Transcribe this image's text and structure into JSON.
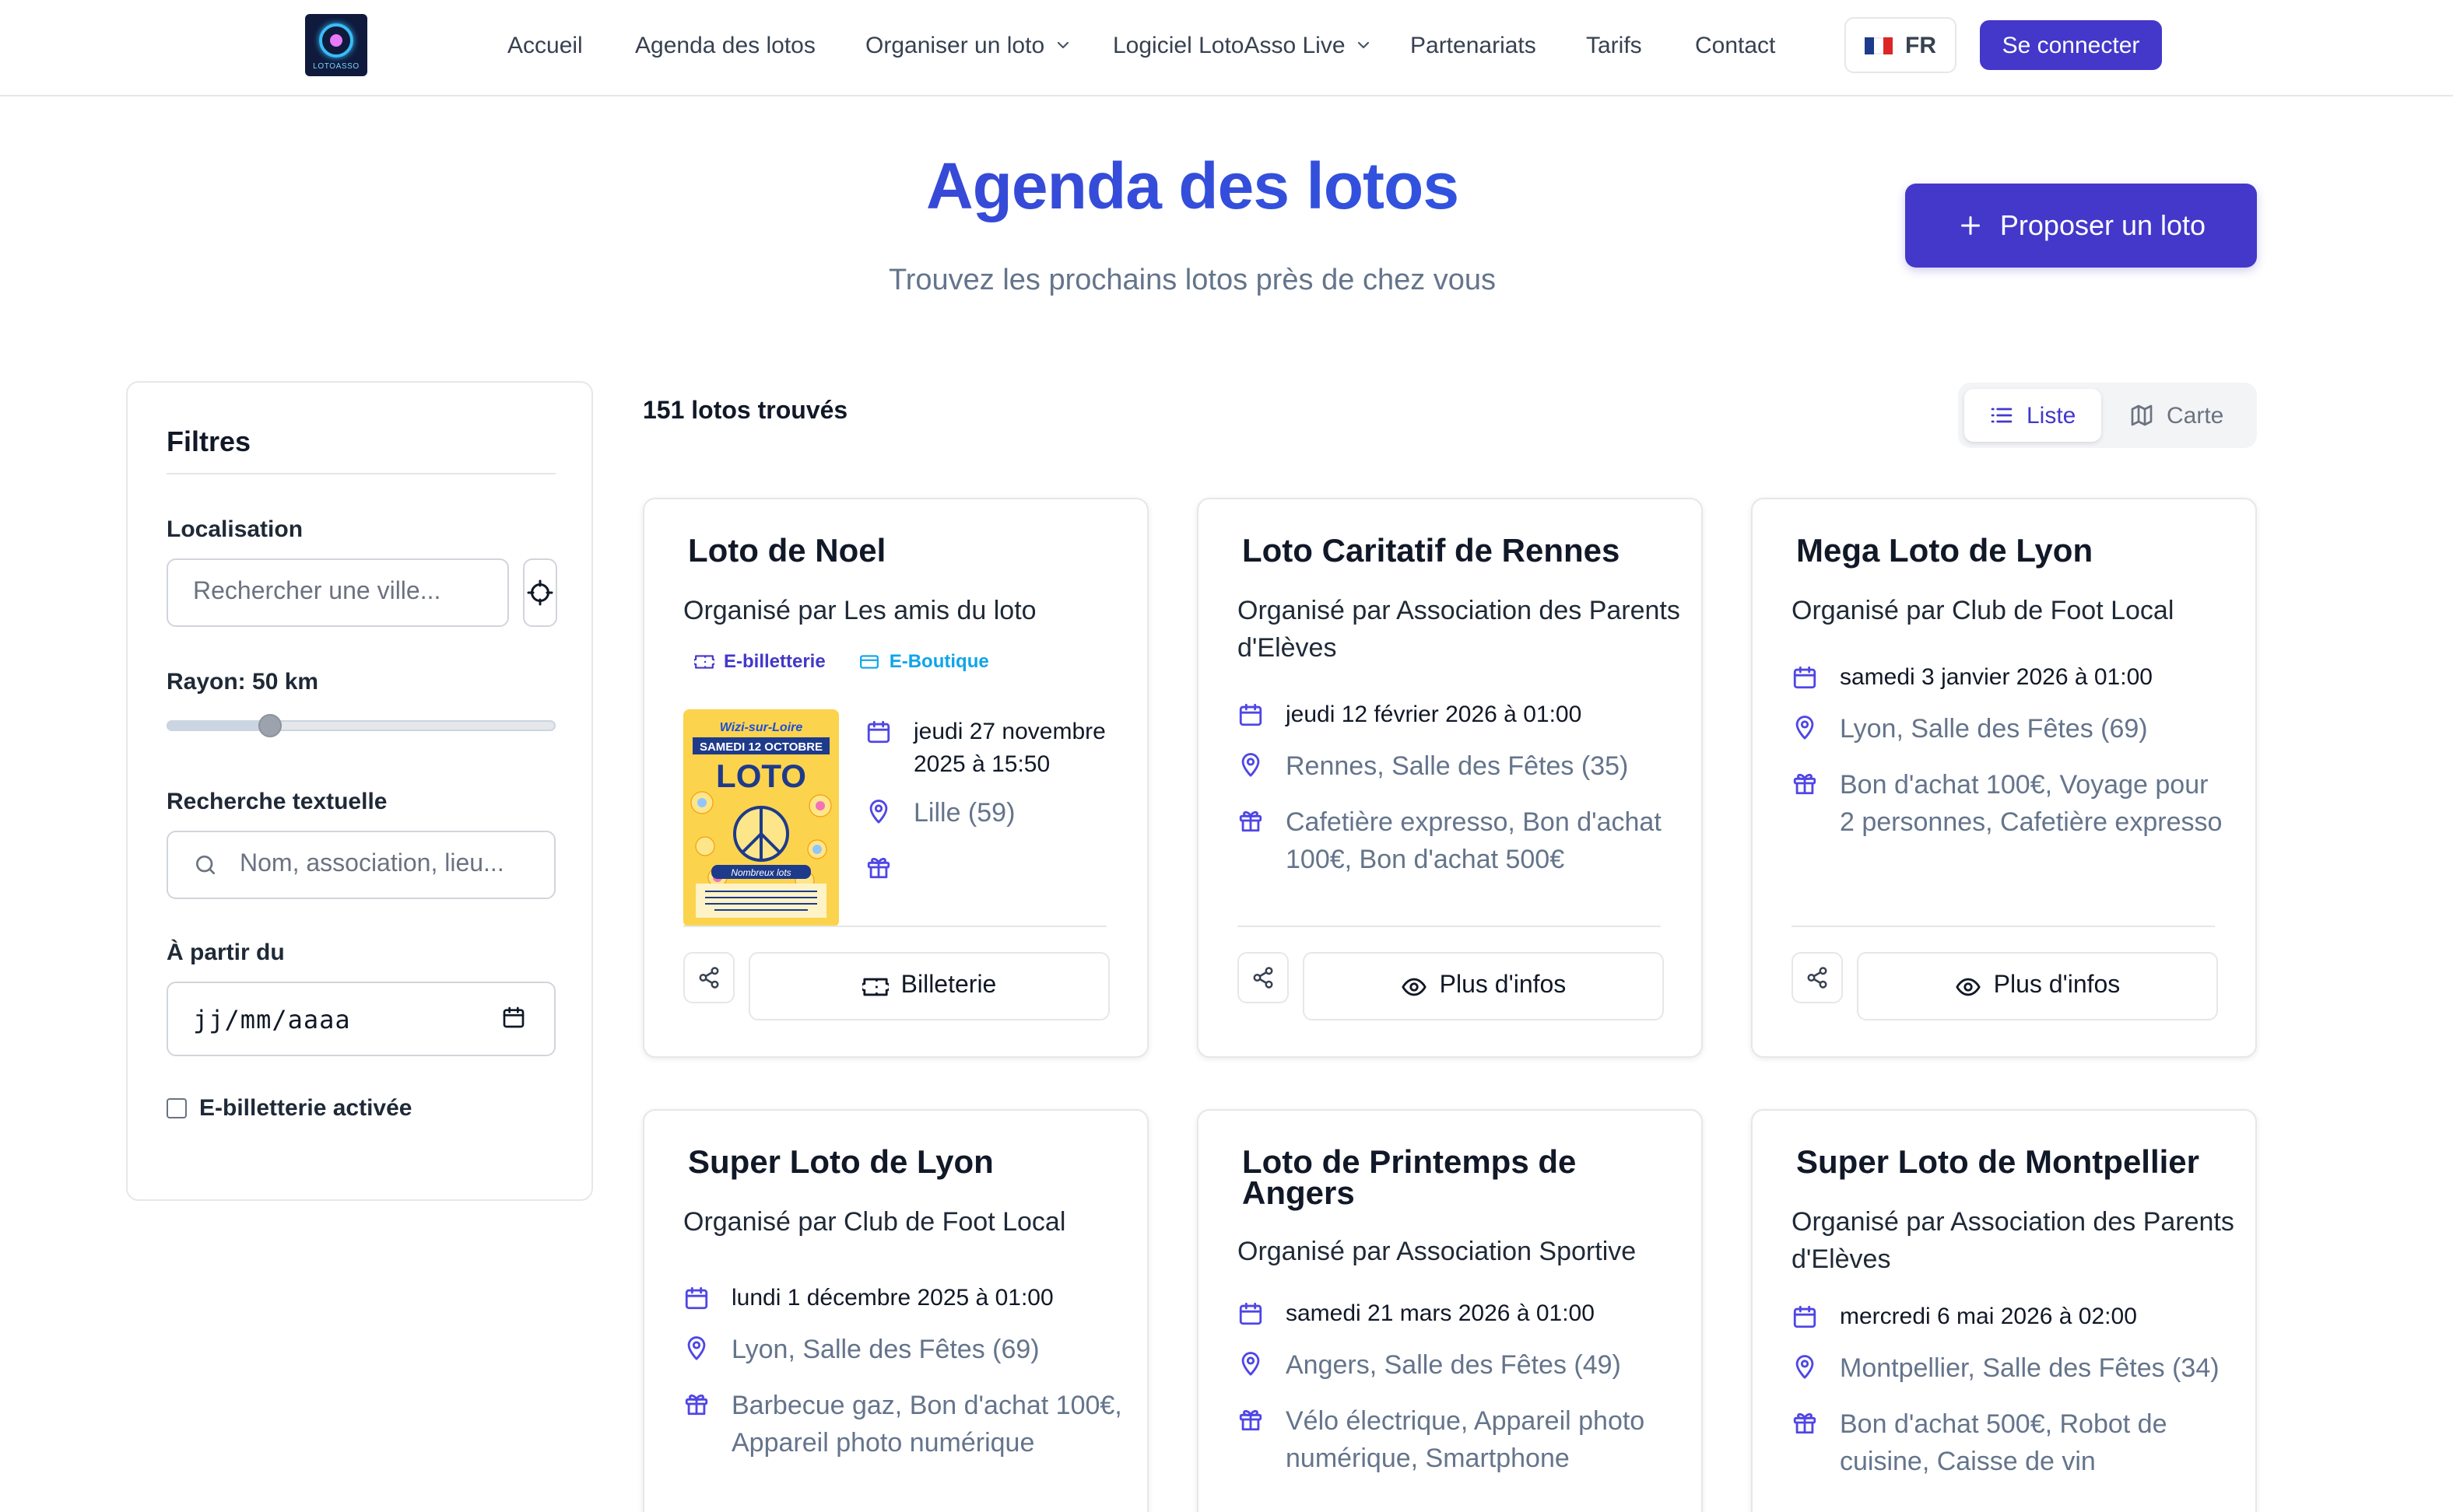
{
  "header": {
    "logo_text": "LOTOASSO",
    "nav": {
      "accueil": "Accueil",
      "agenda": "Agenda des lotos",
      "organiser": "Organiser un loto",
      "logiciel": "Logiciel LotoAsso Live",
      "partenariats": "Partenariats",
      "tarifs": "Tarifs",
      "contact": "Contact"
    },
    "lang": "FR",
    "login": "Se connecter"
  },
  "hero": {
    "title": "Agenda des lotos",
    "subtitle": "Trouvez les prochains lotos près de chez vous",
    "propose_label": "Proposer un loto"
  },
  "filters": {
    "title": "Filtres",
    "location_label": "Localisation",
    "location_placeholder": "Rechercher une ville...",
    "radius_label": "Rayon: 50 km",
    "radius_value_km": 50,
    "radius_slider_fraction": 0.25,
    "text_search_label": "Recherche textuelle",
    "text_search_placeholder": "Nom, association, lieu...",
    "from_label": "À partir du",
    "date_placeholder": "jj/mm/aaaa",
    "eticket_label": "E-billetterie activée",
    "eticket_checked": false
  },
  "results": {
    "count_label": "151 lotos trouvés",
    "view_list": "Liste",
    "view_map": "Carte",
    "active_view": "Liste"
  },
  "poster": {
    "line1": "Wizi-sur-Loire",
    "line2": "SAMEDI 12 OCTOBRE",
    "line3": "LOTO",
    "line4": "Nombreux lots"
  },
  "cards": [
    {
      "title": "Loto de Noel",
      "organizer": "Organisé par Les amis du loto",
      "badges": [
        "E-billetterie",
        "E-Boutique"
      ],
      "date": "jeudi 27 novembre 2025 à 15:50",
      "location": "Lille (59)",
      "prizes": "",
      "action": "Billeterie"
    },
    {
      "title": "Loto Caritatif de Rennes",
      "organizer": "Organisé par Association des Parents d'Elèves",
      "date": "jeudi 12 février 2026 à 01:00",
      "location": "Rennes, Salle des Fêtes (35)",
      "prizes": "Cafetière expresso, Bon d'achat 100€, Bon d'achat 500€",
      "action": "Plus d'infos"
    },
    {
      "title": "Mega Loto de Lyon",
      "organizer": "Organisé par Club de Foot Local",
      "date": "samedi 3 janvier 2026 à 01:00",
      "location": "Lyon, Salle des Fêtes (69)",
      "prizes": "Bon d'achat 100€, Voyage pour 2 personnes, Cafetière expresso",
      "action": "Plus d'infos"
    },
    {
      "title": "Super Loto de Lyon",
      "organizer": "Organisé par Club de Foot Local",
      "date": "lundi 1 décembre 2025 à 01:00",
      "location": "Lyon, Salle des Fêtes (69)",
      "prizes": "Barbecue gaz, Bon d'achat 100€, Appareil photo numérique",
      "action": "Plus d'infos"
    },
    {
      "title": "Loto de Printemps de Angers",
      "organizer": "Organisé par Association Sportive",
      "date": "samedi 21 mars 2026 à 01:00",
      "location": "Angers, Salle des Fêtes (49)",
      "prizes": "Vélo électrique, Appareil photo numérique, Smartphone",
      "action": "Plus d'infos"
    },
    {
      "title": "Super Loto de Montpellier",
      "organizer": "Organisé par Association des Parents d'Elèves",
      "date": "mercredi 6 mai 2026 à 02:00",
      "location": "Montpellier, Salle des Fêtes (34)",
      "prizes": "Bon d'achat 500€, Robot de cuisine, Caisse de vin",
      "action": "Plus d'infos"
    }
  ],
  "colors": {
    "primary": "#4338ca",
    "accent_blue": "#2563eb",
    "icon_purple": "#4f46e5",
    "eboutique_blue": "#0ea5e9",
    "muted_text": "#64748b"
  }
}
